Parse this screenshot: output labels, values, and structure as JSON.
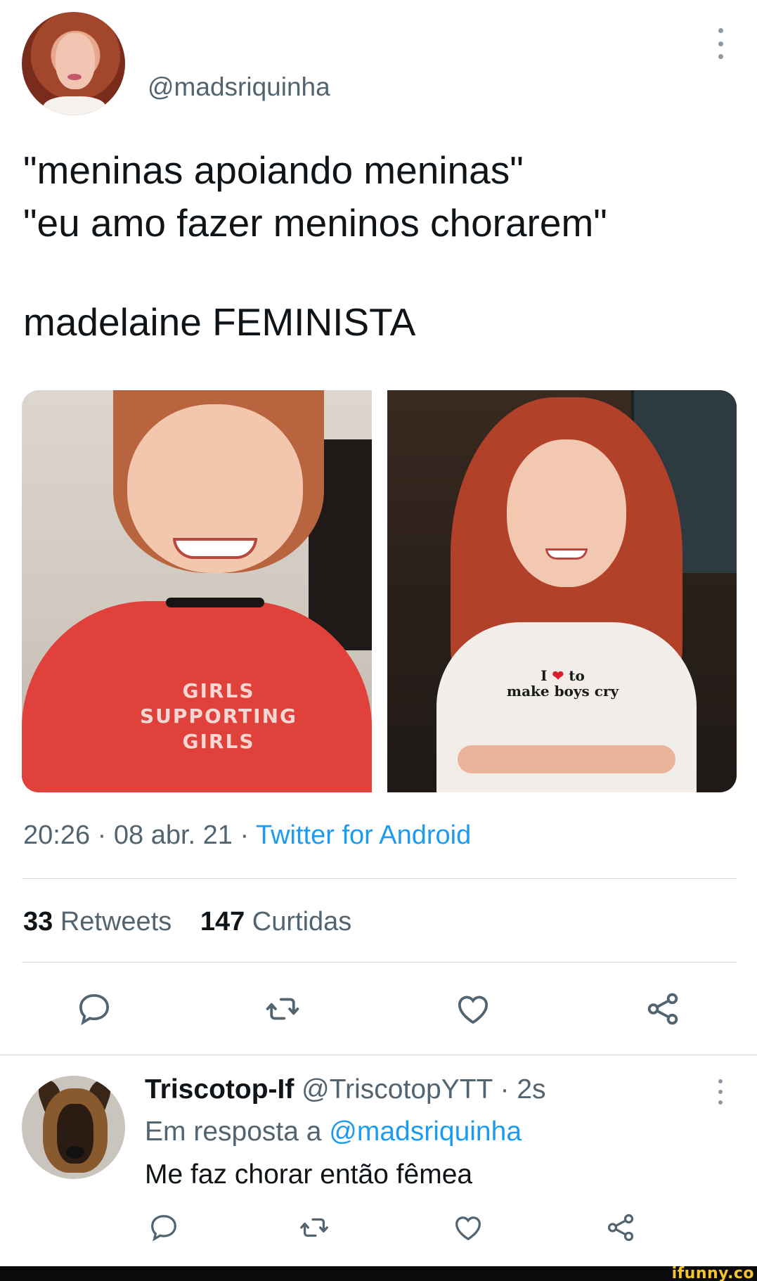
{
  "tweet": {
    "handle": "@madsriquinha",
    "lines": [
      "\"meninas apoiando meninas\"",
      "\"eu amo fazer meninos chorarem\"",
      "madelaine FEMINISTA"
    ],
    "time": "20:26 · 08 abr. 21 · ",
    "source": "Twitter for Android",
    "retweets_count": "33",
    "retweets_label": "Retweets",
    "likes_count": "147",
    "likes_label": "Curtidas",
    "media": {
      "left_shirt_text": [
        "GIRLS",
        "SUPPORTING",
        "GIRLS"
      ],
      "right_shirt_text": [
        "I",
        "to",
        "make boys cry"
      ]
    }
  },
  "reply": {
    "display_name": "Triscotop-If",
    "handle_time": " @TriscotopYTT · 2s",
    "reply_prefix": "Em resposta a ",
    "reply_mention": "@madsriquinha",
    "text": "Me faz chorar  então fêmea"
  },
  "icons": {
    "reply": "reply-icon",
    "retweet": "retweet-icon",
    "like": "heart-icon",
    "share": "share-icon",
    "more": "more-vertical-icon"
  },
  "colors": {
    "accent": "#1d9bf0",
    "muted": "#536471",
    "text": "#0f1419",
    "icon": "#536471"
  },
  "watermark": "ifunny.co"
}
